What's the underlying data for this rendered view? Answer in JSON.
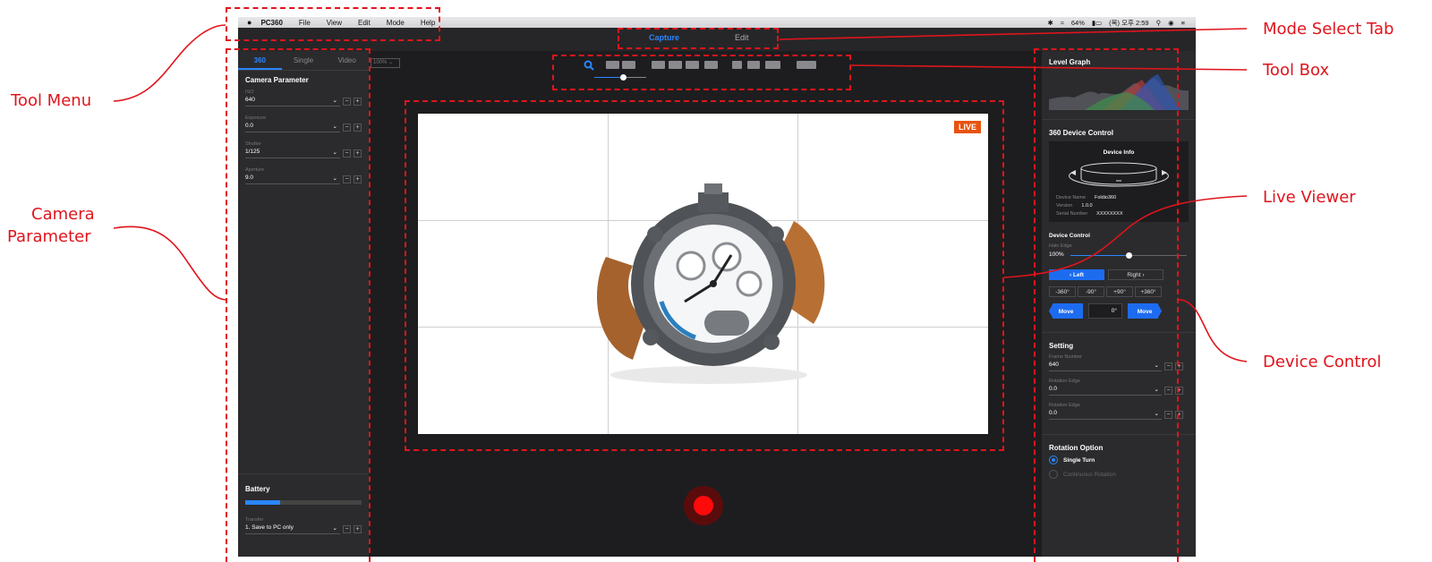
{
  "annotations": {
    "tool_menu": "Tool Menu",
    "camera_parameter_1": "Camera",
    "camera_parameter_2": "Parameter",
    "mode_select_tab": "Mode Select Tab",
    "tool_box": "Tool Box",
    "live_viewer": "Live Viewer",
    "device_control": "Device Control"
  },
  "menubar": {
    "apple": "",
    "app_name": "PC360",
    "items": [
      "File",
      "View",
      "Edit",
      "Mode",
      "Help"
    ],
    "battery": "64%",
    "clock": "(목) 오후 2:59"
  },
  "mode_tabs": {
    "capture": "Capture",
    "edit": "Edit"
  },
  "left_panel": {
    "tabs": [
      "360",
      "Single",
      "Video"
    ],
    "title": "Camera Parameter",
    "params": [
      {
        "label": "ISO",
        "value": "640"
      },
      {
        "label": "Exposure",
        "value": "0.0"
      },
      {
        "label": "Shutter",
        "value": "1/125"
      },
      {
        "label": "Aperture",
        "value": "9.0"
      }
    ],
    "battery_title": "Battery",
    "battery_level": 0.3,
    "transfer_label": "Transfer",
    "transfer_value": "1. Save to PC only"
  },
  "center": {
    "zoom": "100%",
    "live_badge": "LIVE",
    "slider_value": 0.55
  },
  "right_panel": {
    "level_graph": "Level Graph",
    "device_control_title": "360 Device Control",
    "device_info_title": "Device Info",
    "device_info": [
      {
        "label": "Device Name",
        "value": "Foldio360"
      },
      {
        "label": "Version",
        "value": "1.0.0"
      },
      {
        "label": "Serial Number",
        "value": "XXXXXXXX"
      }
    ],
    "device_control": "Device Control",
    "halo_edge_label": "Halo Edge",
    "halo_edge_value": "100%",
    "halo_edge_level": 0.5,
    "left_btn": "‹ Left",
    "right_btn": "Right ›",
    "angles": [
      "-360°",
      "-90°",
      "+90°",
      "+360°"
    ],
    "move_left": "Move",
    "move_right": "Move",
    "angle_value": "0°",
    "setting_title": "Setting",
    "settings": [
      {
        "label": "Frame Number",
        "value": "640"
      },
      {
        "label": "Rotation Edge",
        "value": "0.0"
      },
      {
        "label": "Rotation Edge",
        "value": "0.0"
      }
    ],
    "rotation_title": "Rotation Option",
    "rotation_options": [
      "Single Turn",
      "Continuous Rotation"
    ]
  },
  "colors": {
    "accent": "#2a86ff",
    "annotation": "#e0141c",
    "live": "#e8530f",
    "record": "#ff0a0a"
  }
}
